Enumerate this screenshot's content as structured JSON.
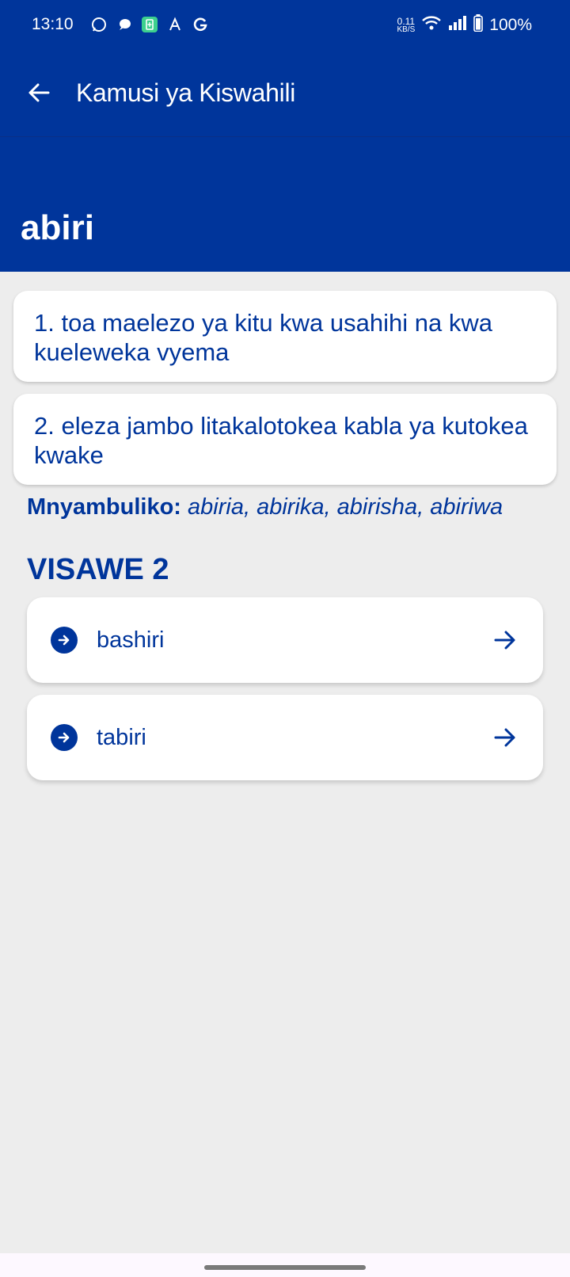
{
  "status_bar": {
    "time": "13:10",
    "net_speed_value": "0.11",
    "net_speed_unit": "KB/S",
    "battery": "100%",
    "notification_icons": [
      "whatsapp-icon",
      "chat-bubble-icon",
      "battery-saver-icon",
      "trending-icon",
      "google-icon"
    ]
  },
  "app_bar": {
    "title": "Kamusi ya Kiswahili",
    "back_icon": "arrow-left-icon"
  },
  "word": {
    "title": "abiri"
  },
  "definitions": [
    {
      "text": "1. toa maelezo ya kitu kwa usahihi na kwa kueleweka vyema"
    },
    {
      "text": "2. eleza jambo litakalotokea kabla ya kutokea kwake"
    }
  ],
  "derivatives": {
    "label": "Mnyambuliko:",
    "values": "abiria, abirika, abirisha, abiriwa"
  },
  "synonyms": {
    "heading": "VISAWE 2",
    "items": [
      {
        "label": "bashiri",
        "leading_icon": "arrow-right-circle-icon",
        "trailing_icon": "arrow-right-icon"
      },
      {
        "label": "tabiri",
        "leading_icon": "arrow-right-circle-icon",
        "trailing_icon": "arrow-right-icon"
      }
    ]
  },
  "colors": {
    "primary": "#00359b",
    "background": "#ededed",
    "card": "#ffffff"
  }
}
